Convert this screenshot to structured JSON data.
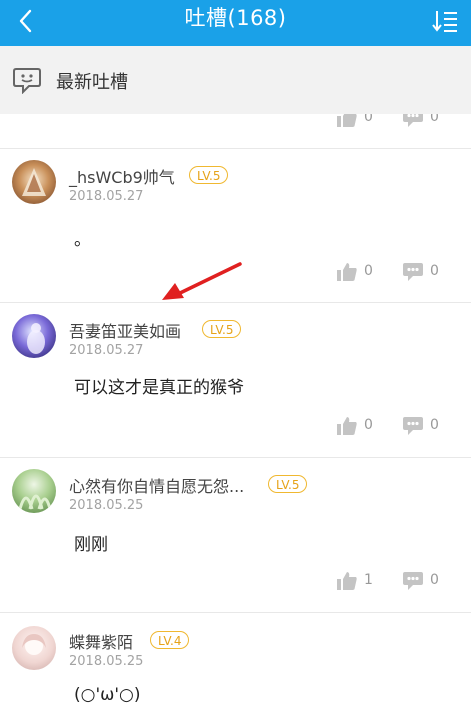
{
  "header": {
    "title": "吐槽(168)"
  },
  "section": {
    "title": "最新吐槽"
  },
  "partial_row": {
    "likes": "0",
    "comments": "0"
  },
  "posts": [
    {
      "username": "_hsWCb9帅气",
      "level": "LV.5",
      "date": "2018.05.27",
      "content": "。",
      "likes": "0",
      "comments": "0"
    },
    {
      "username": "吾妻笛亚美如画",
      "level": "LV.5",
      "date": "2018.05.27",
      "content": "可以这才是真正的猴爷",
      "likes": "0",
      "comments": "0"
    },
    {
      "username": "心然有你自情自愿无怨...",
      "level": "LV.5",
      "date": "2018.05.25",
      "content": "刚刚",
      "likes": "1",
      "comments": "0"
    },
    {
      "username": "蝶舞紫陌",
      "level": "LV.4",
      "date": "2018.05.25",
      "content": "(○'ω'○)"
    }
  ],
  "colors": {
    "header_bg": "#1aa1e8",
    "level_badge": "#e6a319",
    "arrow": "#e02020"
  }
}
